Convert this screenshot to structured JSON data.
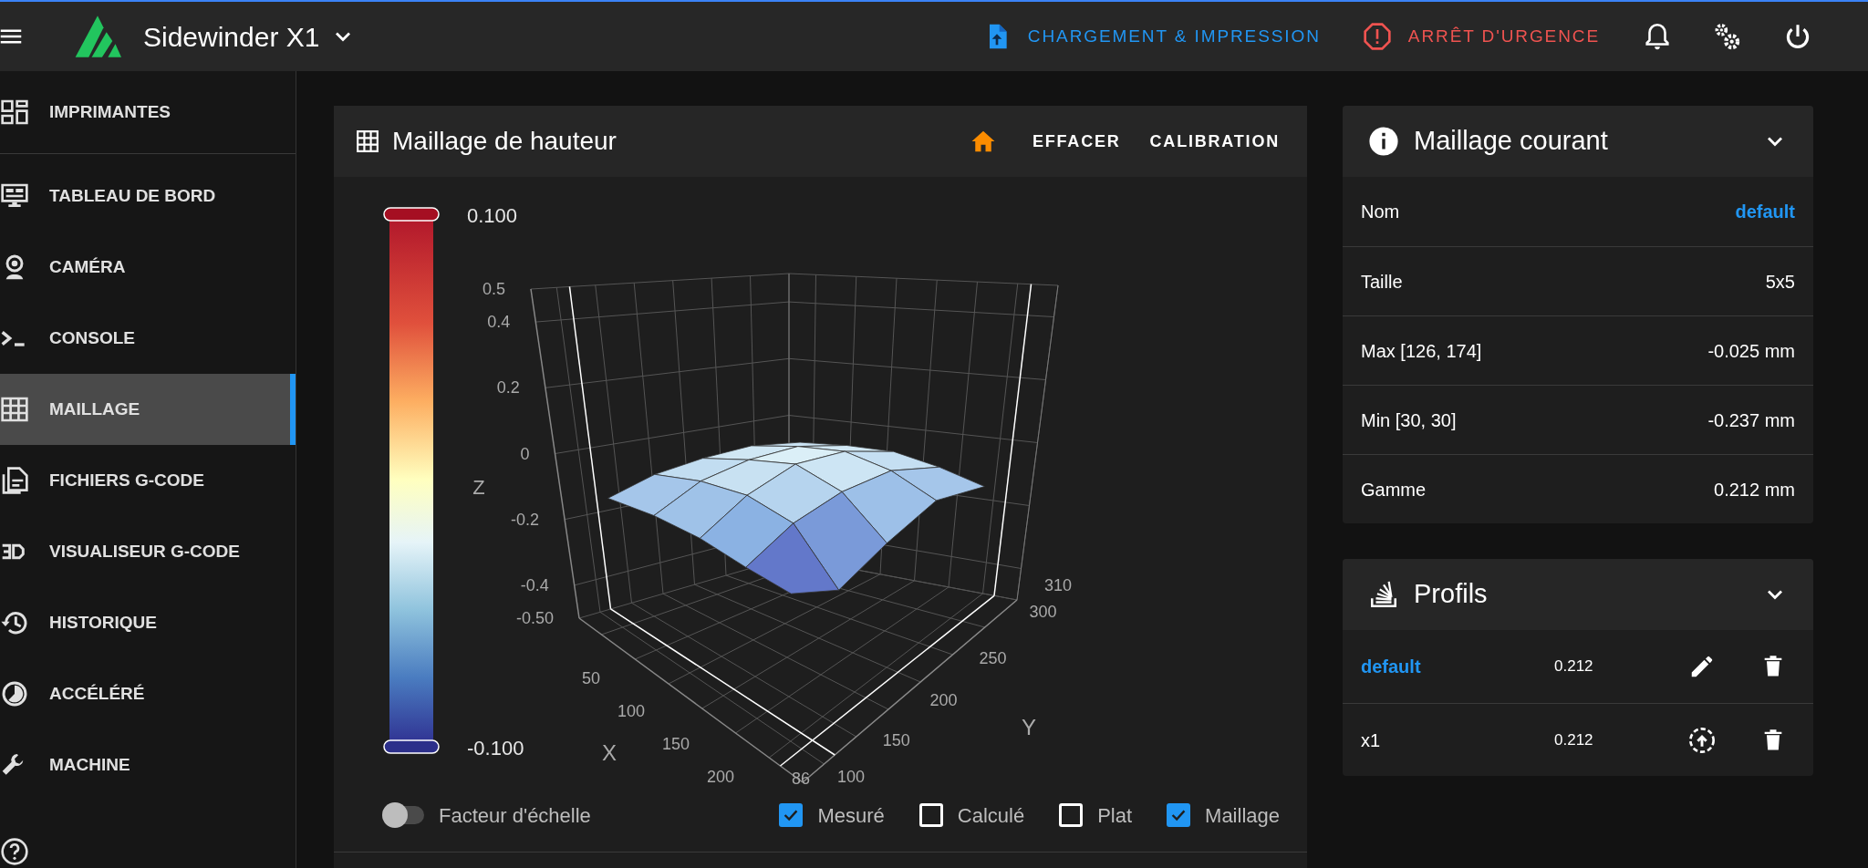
{
  "app_bar": {
    "printer_name": "Sidewinder X1",
    "actions": [
      {
        "kind": "primary",
        "label": "CHARGEMENT & IMPRESSION"
      },
      {
        "kind": "danger",
        "label": "ARRÊT D'URGENCE"
      }
    ]
  },
  "sidebar": {
    "items": [
      {
        "label": "IMPRIMANTES",
        "selected": false
      },
      {
        "label": "TABLEAU DE BORD",
        "selected": false
      },
      {
        "label": "CAMÉRA",
        "selected": false
      },
      {
        "label": "CONSOLE",
        "selected": false
      },
      {
        "label": "MAILLAGE",
        "selected": true
      },
      {
        "label": "FICHIERS G-CODE",
        "selected": false
      },
      {
        "label": "VISUALISEUR G-CODE",
        "selected": false
      },
      {
        "label": "HISTORIQUE",
        "selected": false
      },
      {
        "label": "ACCÉLÉRÉ",
        "selected": false
      },
      {
        "label": "MACHINE",
        "selected": false
      }
    ]
  },
  "mesh": {
    "title": "Maillage de hauteur",
    "buttons": [
      "EFFACER",
      "CALIBRATION"
    ],
    "colorbar": {
      "max": "0.100",
      "min": "-0.100"
    },
    "plot": {
      "z_title": "Z",
      "x_title": "X",
      "y_title": "Y",
      "z_ticks": [
        "0.5",
        "0.4",
        "0.2",
        "0",
        "-0.2",
        "-0.4",
        "-0.50"
      ],
      "x_ticks": [
        "50",
        "100",
        "150",
        "200"
      ],
      "y_ticks": [
        "310",
        "300",
        "250",
        "200",
        "150",
        "100",
        "86"
      ]
    },
    "scale_toggle": {
      "label": "Facteur d'échelle",
      "on": false
    },
    "checkboxes": [
      {
        "label": "Mesuré",
        "checked": true
      },
      {
        "label": "Calculé",
        "checked": false
      },
      {
        "label": "Plat",
        "checked": false
      },
      {
        "label": "Maillage",
        "checked": true
      }
    ]
  },
  "current_mesh": {
    "title": "Maillage courant",
    "rows": [
      {
        "label": "Nom",
        "value": "default",
        "kind": "link"
      },
      {
        "label": "Taille",
        "value": "5x5",
        "kind": "text"
      },
      {
        "label": "Max [126, 174]",
        "value": "-0.025 mm",
        "kind": "text"
      },
      {
        "label": "Min [30, 30]",
        "value": "-0.237 mm",
        "kind": "text"
      },
      {
        "label": "Gamme",
        "value": "0.212 mm",
        "kind": "text"
      }
    ]
  },
  "profiles": {
    "title": "Profils",
    "rows": [
      {
        "name": "default",
        "range": "0.212",
        "selected": true
      },
      {
        "name": "x1",
        "range": "0.212",
        "selected": false
      }
    ]
  }
}
